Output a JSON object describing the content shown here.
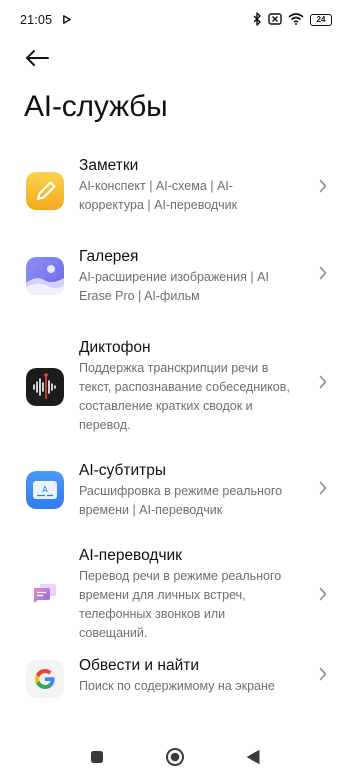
{
  "status_bar": {
    "time": "21:05",
    "battery_level": "24",
    "icons": [
      "play-icon",
      "bluetooth-icon",
      "sim-card-off-icon",
      "wifi-icon",
      "battery-icon"
    ]
  },
  "header": {
    "title": "AI-службы",
    "back_icon": "arrow-left-icon"
  },
  "services": [
    {
      "title": "Заметки",
      "desc_lines": [
        "AI-конспект | AI-схема | AI-",
        "корректура | AI-переводчик"
      ],
      "icon": "notes-pencil-icon",
      "color": "#F6B622"
    },
    {
      "title": "Галерея",
      "desc_lines": [
        "AI-расширение изображения | AI",
        "Erase Pro | AI-фильм"
      ],
      "icon": "gallery-mountain-icon",
      "color": "#7B7BF0"
    },
    {
      "title": "Диктофон",
      "desc_lines": [
        "Поддержка транскрипции речи в",
        "текст, распознавание собеседников,",
        "составление кратких сводок и",
        "перевод."
      ],
      "icon": "recorder-waveform-icon",
      "color": "#1E1E1E"
    },
    {
      "title": "AI-субтитры",
      "desc_lines": [
        "Расшифровка в режиме реального",
        "времени | AI-переводчик"
      ],
      "icon": "subtitles-icon",
      "color": "#3D8BF2"
    },
    {
      "title": "AI-переводчик",
      "desc_lines": [
        "Перевод речи в режиме реального",
        "времени для личных встреч,",
        "телефонных звонков или",
        "совещаний."
      ],
      "icon": "translator-chat-icon",
      "color": "#C86BD8"
    },
    {
      "title": "Обвести и найти",
      "desc_lines": [
        "Поиск по содержимому на экране"
      ],
      "icon": "google-g-icon",
      "color": "#4285F4"
    }
  ],
  "nav_bar": {
    "icons": [
      "recents-square-icon",
      "home-circle-icon",
      "back-triangle-icon"
    ]
  }
}
